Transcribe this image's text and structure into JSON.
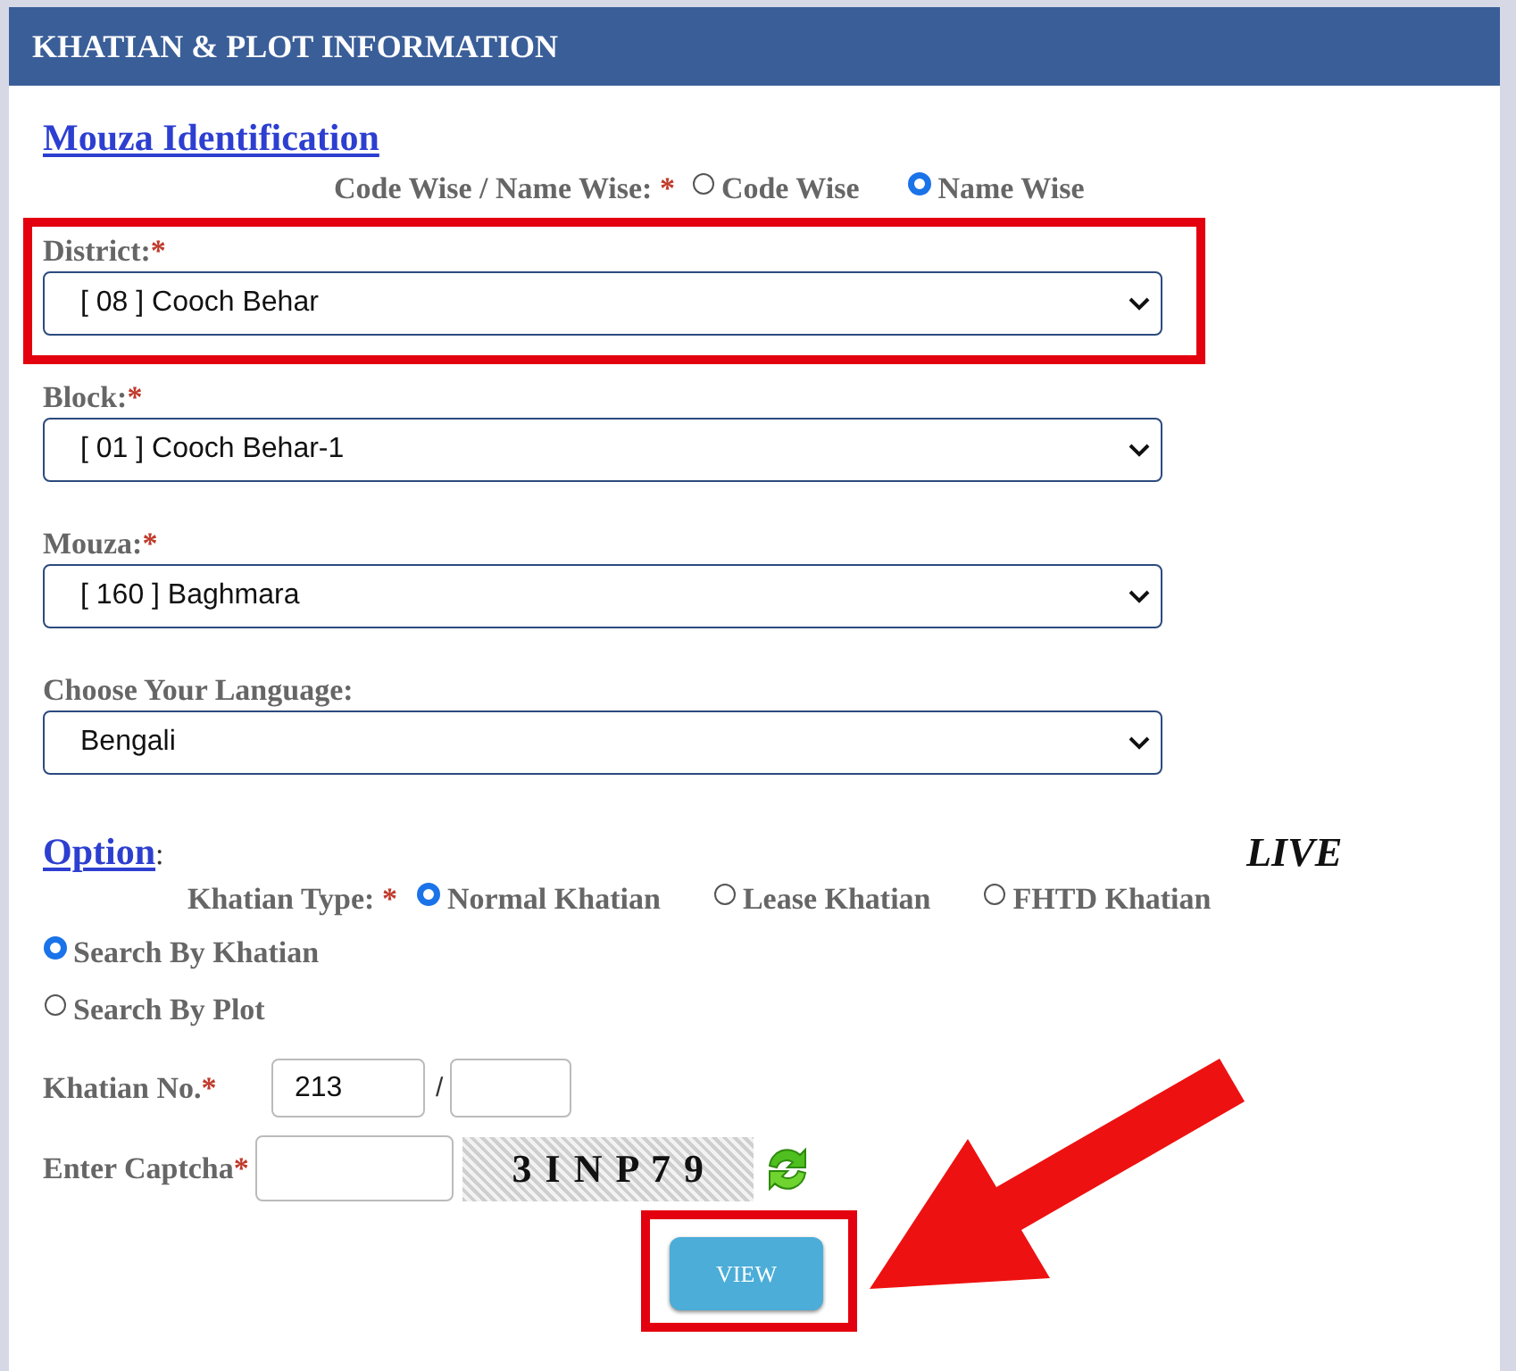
{
  "header": {
    "title": "KHATIAN & PLOT INFORMATION"
  },
  "mouza_section": {
    "heading": "Mouza Identification",
    "mode_label": "Code Wise / Name Wise:",
    "required": "*",
    "mode_options": [
      {
        "label": "Code Wise",
        "selected": false
      },
      {
        "label": "Name Wise",
        "selected": true
      }
    ]
  },
  "selects": [
    {
      "label": "District:",
      "required": "*",
      "value": "[ 08 ] Cooch Behar",
      "highlighted": true
    },
    {
      "label": "Block:",
      "required": "*",
      "value": "[ 01 ] Cooch Behar-1",
      "highlighted": false
    },
    {
      "label": "Mouza:",
      "required": "*",
      "value": "[ 160 ] Baghmara",
      "highlighted": false
    },
    {
      "label": "Choose Your Language:",
      "value": "Bengali",
      "highlighted": false
    }
  ],
  "option_section": {
    "heading": "Option",
    "colon": ":",
    "live": "LIVE",
    "type_label": "Khatian Type:",
    "required": "*",
    "khatian_types": [
      {
        "label": "Normal Khatian",
        "selected": true
      },
      {
        "label": "Lease Khatian",
        "selected": false
      },
      {
        "label": "FHTD Khatian",
        "selected": false
      }
    ],
    "search_modes": [
      {
        "label": "Search By Khatian",
        "selected": true
      },
      {
        "label": "Search By Plot",
        "selected": false
      }
    ]
  },
  "khatian_no": {
    "label": "Khatian No.",
    "required": "*",
    "value": "213",
    "separator": "/"
  },
  "captcha": {
    "label": "Enter Captcha",
    "required": "*",
    "code": "3 I N P 7 9"
  },
  "view_button": {
    "label": "VIEW",
    "highlighted": true
  },
  "callout_arrow": true
}
